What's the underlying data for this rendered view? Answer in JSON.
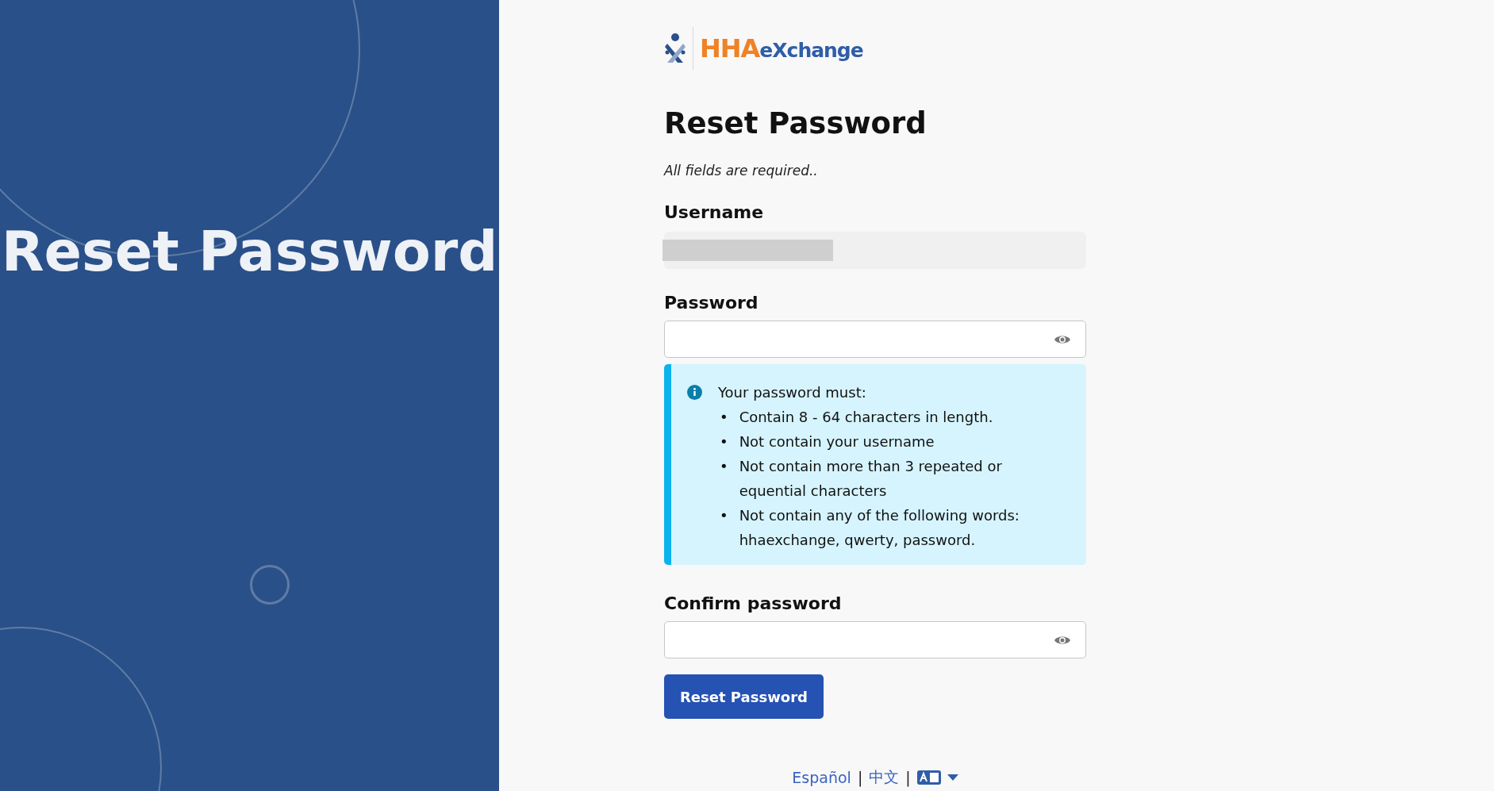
{
  "hero": {
    "title": "Reset Password"
  },
  "logo": {
    "primary": "HHA",
    "secondary": "eXchange"
  },
  "form": {
    "title": "Reset Password",
    "note": "All fields are required..",
    "fields": [
      {
        "kind": "readonly",
        "label": "Username"
      },
      {
        "kind": "password",
        "label": "Password"
      },
      {
        "kind": "info",
        "intro": "Your password must:",
        "bullet": "•",
        "rules": [
          "Contain 8 - 64 characters in length.",
          "Not contain your username",
          "Not contain more than 3 repeated or equential characters",
          "Not contain any of the following words: hhaexchange, qwerty, password."
        ]
      },
      {
        "kind": "password",
        "label": "Confirm password"
      }
    ],
    "submit": "Reset Password"
  },
  "languages": [
    "Español",
    "中文"
  ],
  "language_separator": "|"
}
